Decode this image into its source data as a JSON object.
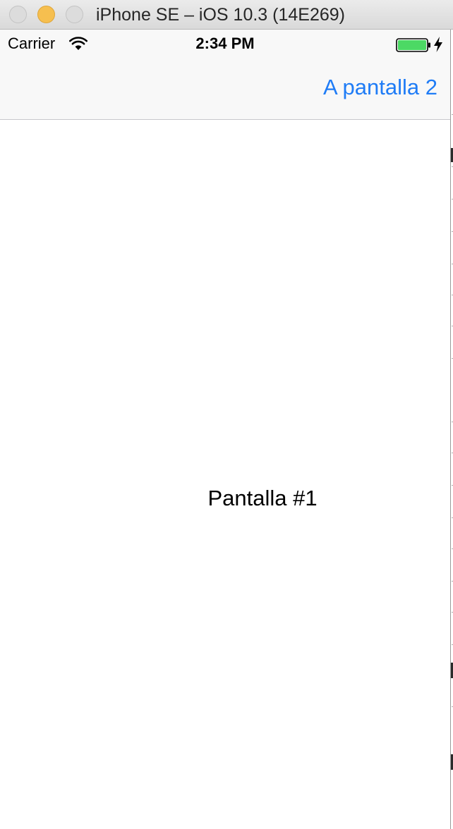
{
  "window": {
    "title": "iPhone SE – iOS 10.3 (14E269)"
  },
  "statusbar": {
    "carrier": "Carrier",
    "time": "2:34 PM",
    "wifi_icon": "wifi-icon",
    "battery_icon": "battery-icon",
    "charging_icon": "charging-bolt-icon",
    "battery_level": 1.0,
    "battery_color": "#4cd964"
  },
  "navbar": {
    "right_button_label": "A pantalla 2",
    "tint_color": "#1f7cf6"
  },
  "content": {
    "label": "Pantalla #1"
  }
}
